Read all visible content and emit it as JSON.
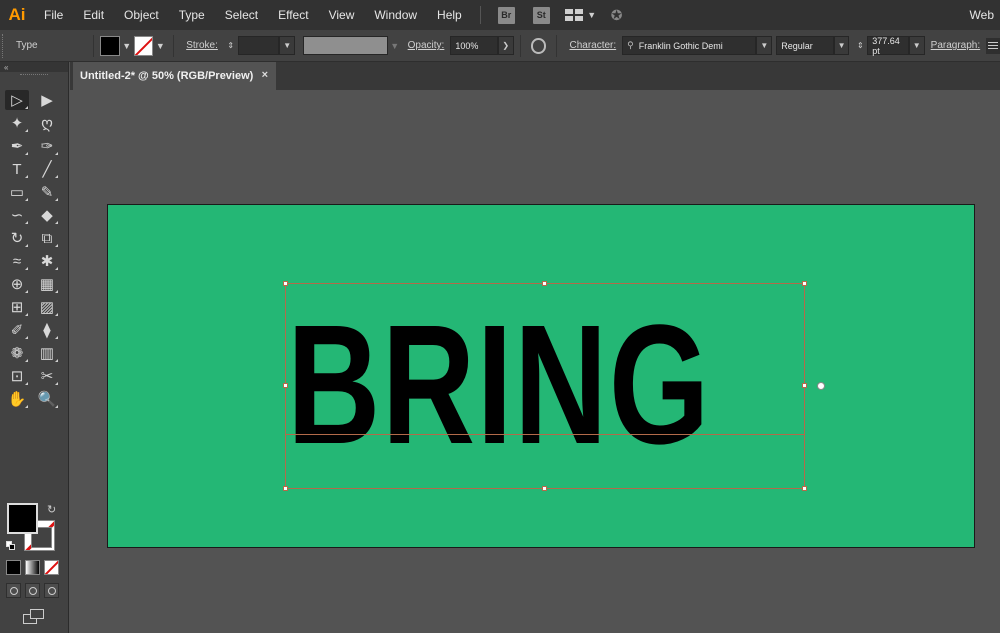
{
  "app": {
    "logo": "Ai",
    "workspace": "Web"
  },
  "menu": [
    "File",
    "Edit",
    "Object",
    "Type",
    "Select",
    "Effect",
    "View",
    "Window",
    "Help"
  ],
  "bridge_buttons": [
    "Br",
    "St"
  ],
  "control": {
    "tool_label": "Type",
    "stroke_label": "Stroke:",
    "opacity_label": "Opacity:",
    "opacity_value": "100%",
    "character_label": "Character:",
    "font_family": "Franklin Gothic Demi",
    "font_style": "Regular",
    "font_size": "377.64 pt",
    "paragraph_label": "Paragraph:"
  },
  "tools": [
    "selection-tool",
    "direct-selection-tool",
    "magic-wand-tool",
    "lasso-tool",
    "pen-tool",
    "curvature-tool",
    "type-tool",
    "line-tool",
    "rectangle-tool",
    "paintbrush-tool",
    "shaper-tool",
    "eraser-tool",
    "rotate-tool",
    "scale-tool",
    "width-tool",
    "puppet-warp-tool",
    "shape-builder-tool",
    "perspective-grid-tool",
    "mesh-tool",
    "gradient-tool",
    "eyedropper-tool",
    "blend-tool",
    "symbol-sprayer-tool",
    "column-graph-tool",
    "artboard-tool",
    "slice-tool",
    "hand-tool",
    "zoom-tool"
  ],
  "tool_glyphs": [
    "▷",
    "▶",
    "✦",
    "ღ",
    "✒",
    "✑",
    "T",
    "╱",
    "▭",
    "✎",
    "∽",
    "◆",
    "↻",
    "⧉",
    "≈",
    "✱",
    "⊕",
    "▦",
    "⊞",
    "▨",
    "✐",
    "⧫",
    "❁",
    "▥",
    "⊡",
    "✂",
    "✋",
    "🔍"
  ],
  "document": {
    "tab_title": "Untitled-2* @ 50% (RGB/Preview)",
    "close": "×"
  },
  "artwork": {
    "text": "BRING",
    "artboard_color": "#24b775"
  }
}
